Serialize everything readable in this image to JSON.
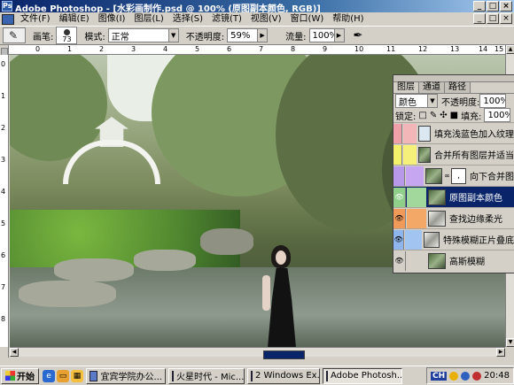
{
  "window": {
    "app_icon_label": "Ps",
    "title": "Adobe Photoshop - [水彩画制作.psd @ 100% (原图副本颜色, RGB)]",
    "buttons": [
      "_",
      "□",
      "×"
    ]
  },
  "menubar": {
    "items": [
      "文件(F)",
      "编辑(E)",
      "图像(I)",
      "图层(L)",
      "选择(S)",
      "滤镜(T)",
      "视图(V)",
      "窗口(W)",
      "帮助(H)"
    ],
    "doc_buttons": [
      "_",
      "□",
      "×"
    ]
  },
  "options_bar": {
    "brush_label": "画笔:",
    "brush_size": "73",
    "mode_label": "模式:",
    "mode_value": "正常",
    "opacity_label": "不透明度:",
    "opacity_value": "59%",
    "flow_label": "流量:",
    "flow_value": "100%"
  },
  "rulers": {
    "h_ticks": [
      "0",
      "1",
      "2",
      "3",
      "4",
      "5",
      "6",
      "7",
      "8",
      "9",
      "10",
      "11",
      "12",
      "13",
      "14",
      "15"
    ],
    "v_ticks": [
      "0",
      "1",
      "2",
      "3",
      "4",
      "5",
      "6",
      "7",
      "8"
    ]
  },
  "layers_panel": {
    "tabs": [
      "图层",
      "通道",
      "路径"
    ],
    "blend_mode": "颜色",
    "opacity_label": "不透明度:",
    "opacity_value": "100%",
    "lock_label": "锁定:",
    "fill_label": "填充:",
    "fill_value": "100%",
    "layers": [
      {
        "name": "填充浅蓝色加入纹理",
        "swatch": "#f0a0a8",
        "swatch2": "#f2b5b8",
        "thumb": "light",
        "visible": false
      },
      {
        "name": "合并所有图层并适当",
        "swatch": "#f3f06a",
        "swatch2": "#f5f07a",
        "thumb": "photo",
        "visible": false
      },
      {
        "name": "向下合并图",
        "swatch": "#b898e8",
        "swatch2": "#c6a6f0",
        "thumb": "photo",
        "visible": false,
        "has_mask": true,
        "mask_label": ","
      },
      {
        "name": "原图副本颜色",
        "swatch": "#8fcf8a",
        "swatch2": "#a2d89c",
        "thumb": "photo",
        "visible": true,
        "selected": true
      },
      {
        "name": "查找边缘柔光",
        "swatch": "#f09a5a",
        "swatch2": "#f4a868",
        "thumb": "sketch",
        "visible": true
      },
      {
        "name": "特殊模糊正片叠底",
        "swatch": "#8fb6ec",
        "swatch2": "#a2c4f0",
        "thumb": "sketch",
        "visible": true
      },
      {
        "name": "高斯模糊",
        "swatch": "#d4d0c8",
        "swatch2": "#d4d0c8",
        "thumb": "photo",
        "visible": true
      }
    ]
  },
  "taskbar": {
    "start_label": "开始",
    "tasks": [
      {
        "label": "宜宾学院办公...",
        "active": false
      },
      {
        "label": "火星时代 - Mic...",
        "active": false
      },
      {
        "label": "2 Windows Ex...",
        "active": false
      },
      {
        "label": "Adobe Photosh...",
        "active": true
      }
    ],
    "ime": "CH",
    "clock": "20:48"
  },
  "colors": {
    "titlebar": "#0a246a",
    "selected_layer": "#0a246a"
  }
}
